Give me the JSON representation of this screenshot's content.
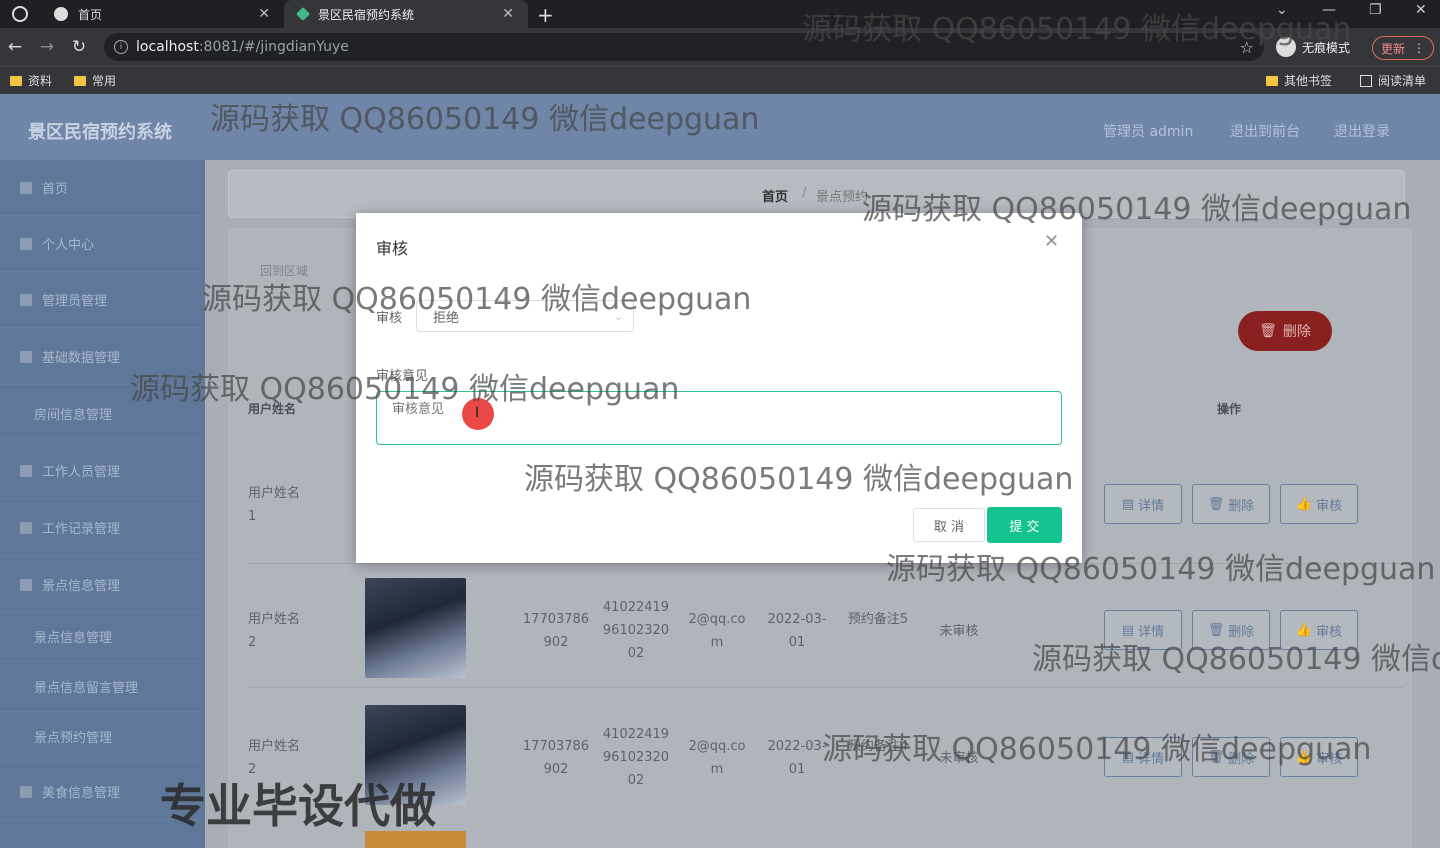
{
  "browser": {
    "tabs": [
      {
        "title": "首页",
        "active": false
      },
      {
        "title": "景区民宿预约系统",
        "active": true
      }
    ],
    "url_host": "localhost",
    "url_path": ":8081/#/jingdianYuye",
    "incognito_label": "无痕模式",
    "update_label": "更新",
    "bookmarks": [
      "资料",
      "常用"
    ],
    "bookmarks_right": [
      "其他书签",
      "阅读清单"
    ]
  },
  "app": {
    "brand": "景区民宿预约系统",
    "top_links": [
      "管理员 admin",
      "退出到前台",
      "退出登录"
    ],
    "sidebar": [
      {
        "label": "首页",
        "sub": false
      },
      {
        "label": "个人中心",
        "sub": false
      },
      {
        "label": "管理员管理",
        "sub": false
      },
      {
        "label": "基础数据管理",
        "sub": false
      },
      {
        "label": "房间信息管理",
        "sub": true
      },
      {
        "label": "工作人员管理",
        "sub": false
      },
      {
        "label": "工作记录管理",
        "sub": false
      },
      {
        "label": "景点信息管理",
        "sub": false
      },
      {
        "label": "景点信息管理",
        "sub": true
      },
      {
        "label": "景点信息留言管理",
        "sub": true
      },
      {
        "label": "景点预约管理",
        "sub": true
      },
      {
        "label": "美食信息管理",
        "sub": false
      }
    ],
    "breadcrumb": {
      "home": "首页",
      "sep": "/",
      "current": "景点预约"
    },
    "search_hint": "回到区域",
    "delete_button": "删除",
    "columns": {
      "name": "用户姓名",
      "ops": "操作"
    },
    "rows": [
      {
        "name": "用户姓名1",
        "phone": "",
        "id": "",
        "email": "",
        "date": "",
        "remark": "",
        "status": ""
      },
      {
        "name": "用户姓名2",
        "phone": "17703786902",
        "id": "410224199610232002",
        "email": "2@qq.com",
        "date": "2022-03-01",
        "remark": "预约备注5",
        "status": "未审核"
      },
      {
        "name": "用户姓名2",
        "phone": "17703786902",
        "id": "410224199610232002",
        "email": "2@qq.com",
        "date": "2022-03-01",
        "remark": "预约备注4",
        "status": "未审核"
      }
    ],
    "row_buttons": {
      "detail": "详情",
      "delete": "删除",
      "audit": "审核"
    }
  },
  "dialog": {
    "title": "审核",
    "audit_label": "审核",
    "audit_value": "拒绝",
    "opinion_label": "审核意见",
    "opinion_placeholder": "审核意见",
    "cancel": "取 消",
    "submit": "提 交"
  },
  "watermarks": {
    "text": "源码获取 QQ86050149 微信deepguan",
    "short": "源码获取 QQ86050149 微信d",
    "big": "专业毕设代做"
  }
}
